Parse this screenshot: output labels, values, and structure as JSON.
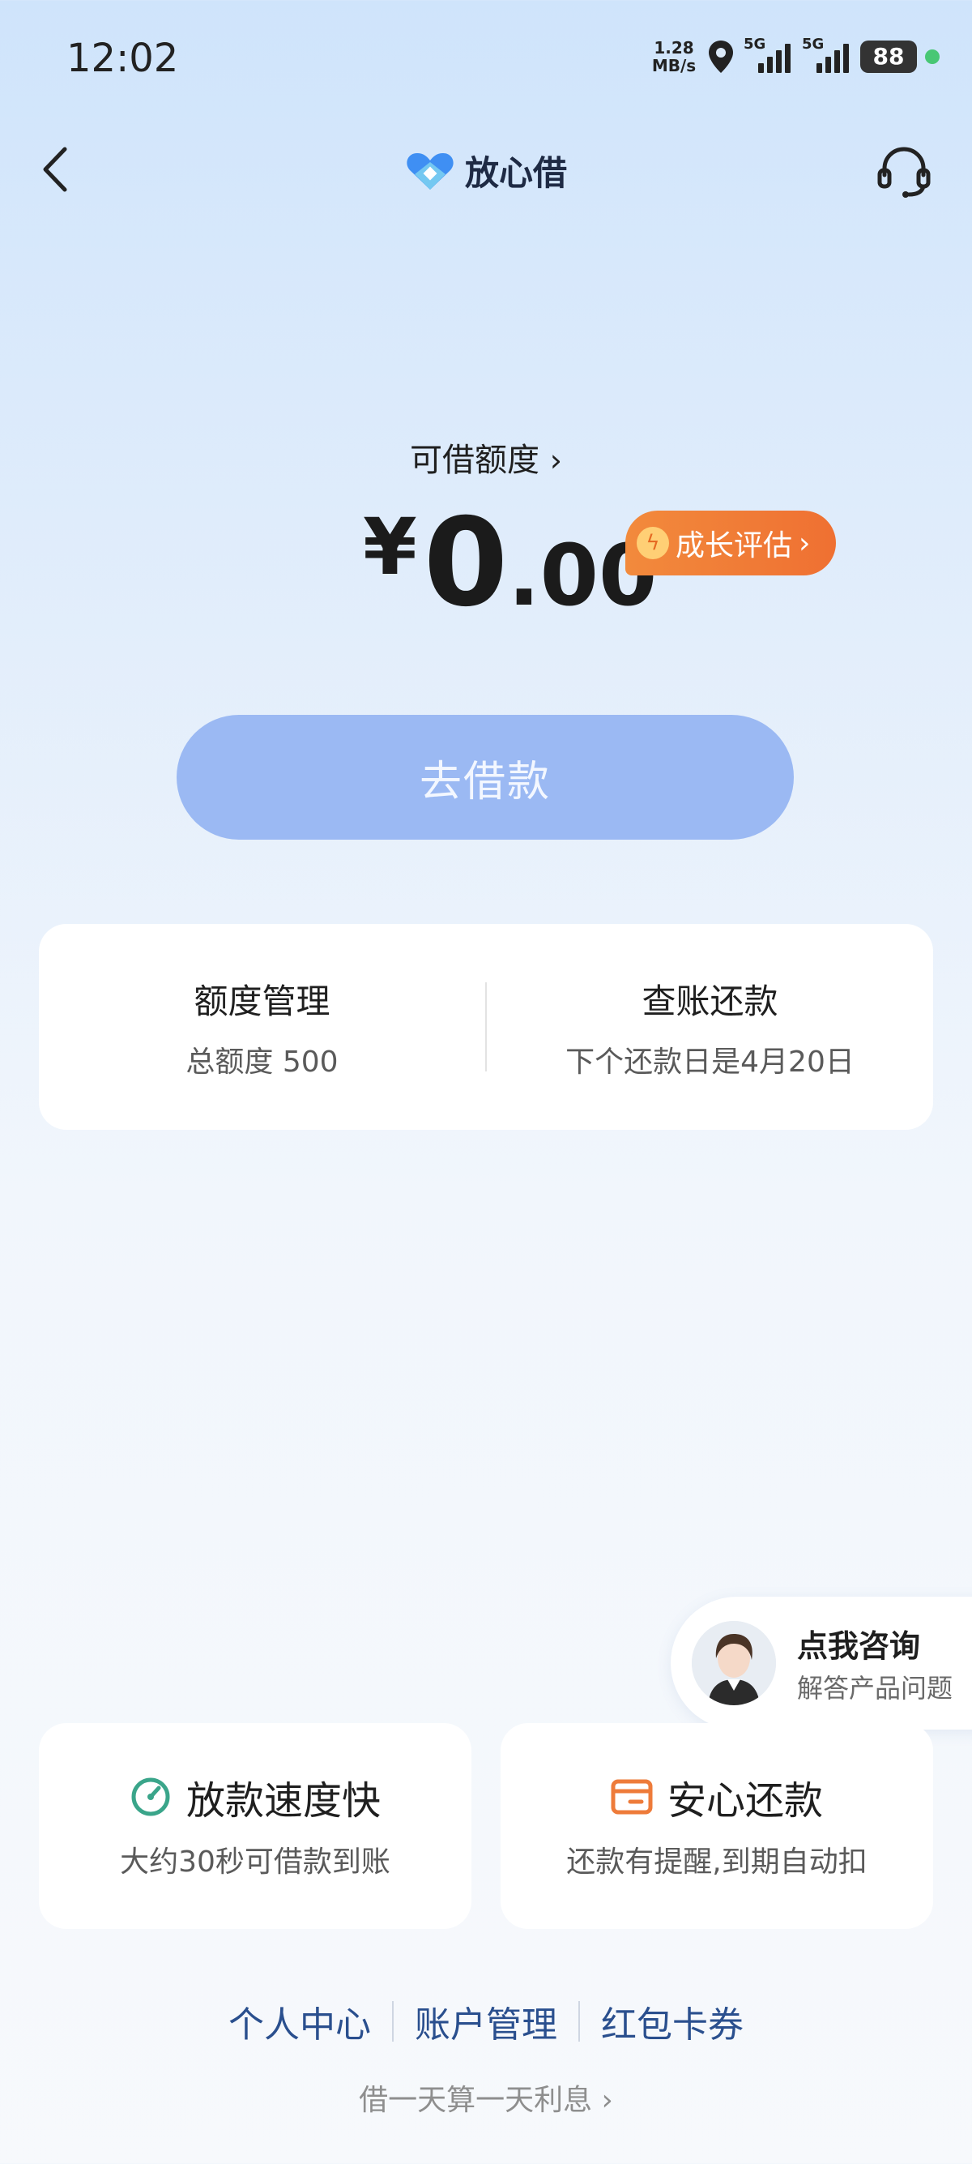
{
  "status_bar": {
    "time": "12:02",
    "net_speed_value": "1.28",
    "net_speed_unit": "MB/s",
    "signal1_label": "5G",
    "signal2_label": "5G",
    "battery": "88"
  },
  "nav": {
    "brand": "放心借"
  },
  "quota": {
    "label": "可借额度",
    "currency": "¥",
    "amount_int": "0",
    "amount_dec": ".00",
    "growth_label": "成长评估"
  },
  "borrow_button": "去借款",
  "management": {
    "left_title": "额度管理",
    "left_sub": "总额度 500",
    "right_title": "查账还款",
    "right_sub": "下个还款日是4月20日"
  },
  "consult": {
    "title": "点我咨询",
    "subtitle": "解答产品问题"
  },
  "features": [
    {
      "title": "放款速度快",
      "subtitle": "大约30秒可借款到账",
      "icon": "speed-gauge-icon",
      "color": "#3aa58a"
    },
    {
      "title": "安心还款",
      "subtitle": "还款有提醒,到期自动扣",
      "icon": "wallet-icon",
      "color": "#ee7b3a"
    }
  ],
  "links": [
    "个人中心",
    "账户管理",
    "红包卡券"
  ],
  "interest_note": "借一天算一天利息"
}
